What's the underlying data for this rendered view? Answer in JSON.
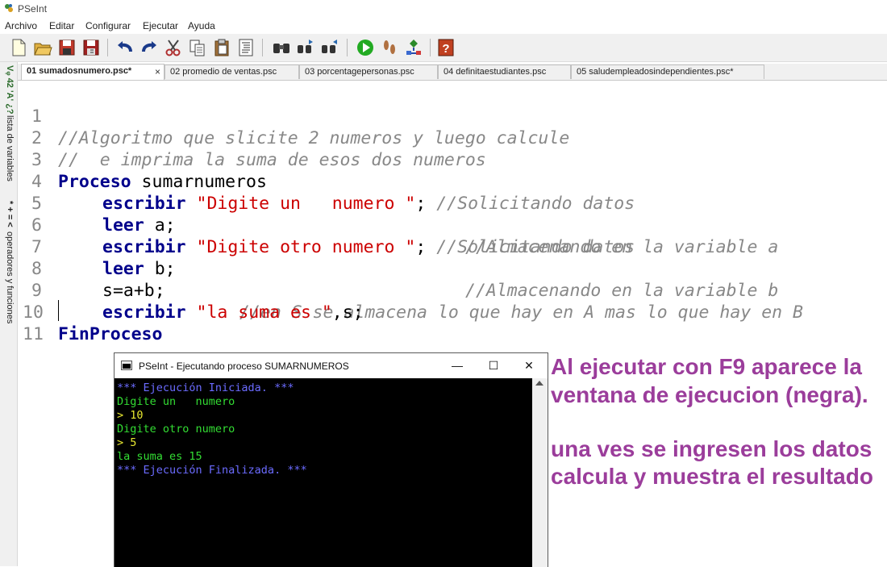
{
  "window": {
    "title": "PSeInt"
  },
  "menu": [
    "Archivo",
    "Editar",
    "Configurar",
    "Ejecutar",
    "Ayuda"
  ],
  "toolbar": [
    "new-file-icon",
    "open-file-icon",
    "save-icon",
    "save-as-icon",
    "undo-icon",
    "redo-icon",
    "cut-icon",
    "copy-icon",
    "paste-icon",
    "indent-icon",
    "find-icon",
    "find-previous-icon",
    "find-next-icon",
    "run-icon",
    "step-by-step-icon",
    "flowchart-icon",
    "help-icon"
  ],
  "side_panel": {
    "variables": "lista de variables",
    "operators": "operadores y funciones",
    "var_glyphs": "Vᵩ 42 'A' ¿?",
    "op_glyphs": "* + = <"
  },
  "tabs": [
    {
      "label": "01 sumadosnumero.psc*",
      "active": true,
      "close": "×"
    },
    {
      "label": "02 promedio de ventas.psc",
      "active": false
    },
    {
      "label": "03 porcentagepersonas.psc",
      "active": false
    },
    {
      "label": "04 definitaestudiantes.psc",
      "active": false
    },
    {
      "label": "05 saludempleadosindependientes.psc*",
      "active": false
    }
  ],
  "code": {
    "line_numbers": [
      "1",
      "2",
      "3",
      "4",
      "5",
      "6",
      "7",
      "8",
      "9",
      "10",
      "11"
    ],
    "l1_comment": "//Algoritmo que slicite 2 numeros y luego calcule",
    "l2_comment": "//  e imprima la suma de esos dos numeros",
    "l3_kw": "Proceso",
    "l3_name": " sumarnumeros",
    "l4_kw": "escribir",
    "l4_str": "\"Digite un   numero \"",
    "l4_semi": "; ",
    "l4_comment": "//Solicitando datos",
    "l5_kw": "leer",
    "l5_rest": " a;",
    "l5_comment": "//Almacenando en la variable a",
    "l6_kw": "escribir",
    "l6_str": "\"Digite otro numero \"",
    "l6_semi": "; ",
    "l6_comment": "//Solicitando datos",
    "l7_kw": "leer",
    "l7_rest": " b;",
    "l7_comment": "//Almacenando en la variable b",
    "l8_code": "s=a+b;",
    "l8_comment": "//en S se almacena lo que hay en A mas lo que hay en B",
    "l9_kw": "escribir",
    "l9_str": "\"la suma es \"",
    "l9_rest": ",s;",
    "l10_kw": "FinProceso"
  },
  "console": {
    "title": "PSeInt - Ejecutando proceso SUMARNUMEROS",
    "buttons": {
      "minimize": "—",
      "maximize": "☐",
      "close": "✕"
    },
    "lines": [
      {
        "text": "*** Ejecución Iniciada. ***",
        "color": "#6b6bff"
      },
      {
        "text": "Digite un   numero",
        "color": "#33dd33"
      },
      {
        "text": "> 10",
        "color": "#e8e830"
      },
      {
        "text": "Digite otro numero",
        "color": "#33dd33"
      },
      {
        "text": "> 5",
        "color": "#e8e830"
      },
      {
        "text": "la suma es 15",
        "color": "#33dd33"
      },
      {
        "text": "*** Ejecución Finalizada. ***",
        "color": "#6b6bff"
      }
    ]
  },
  "annotations": {
    "line1": "Al ejecutar con F9 aparece la",
    "line2": "ventana de ejecucion (negra).",
    "line3": "una ves se ingresen los datos",
    "line4": "calcula y muestra el resultado",
    "color": "#9b3d9b"
  }
}
